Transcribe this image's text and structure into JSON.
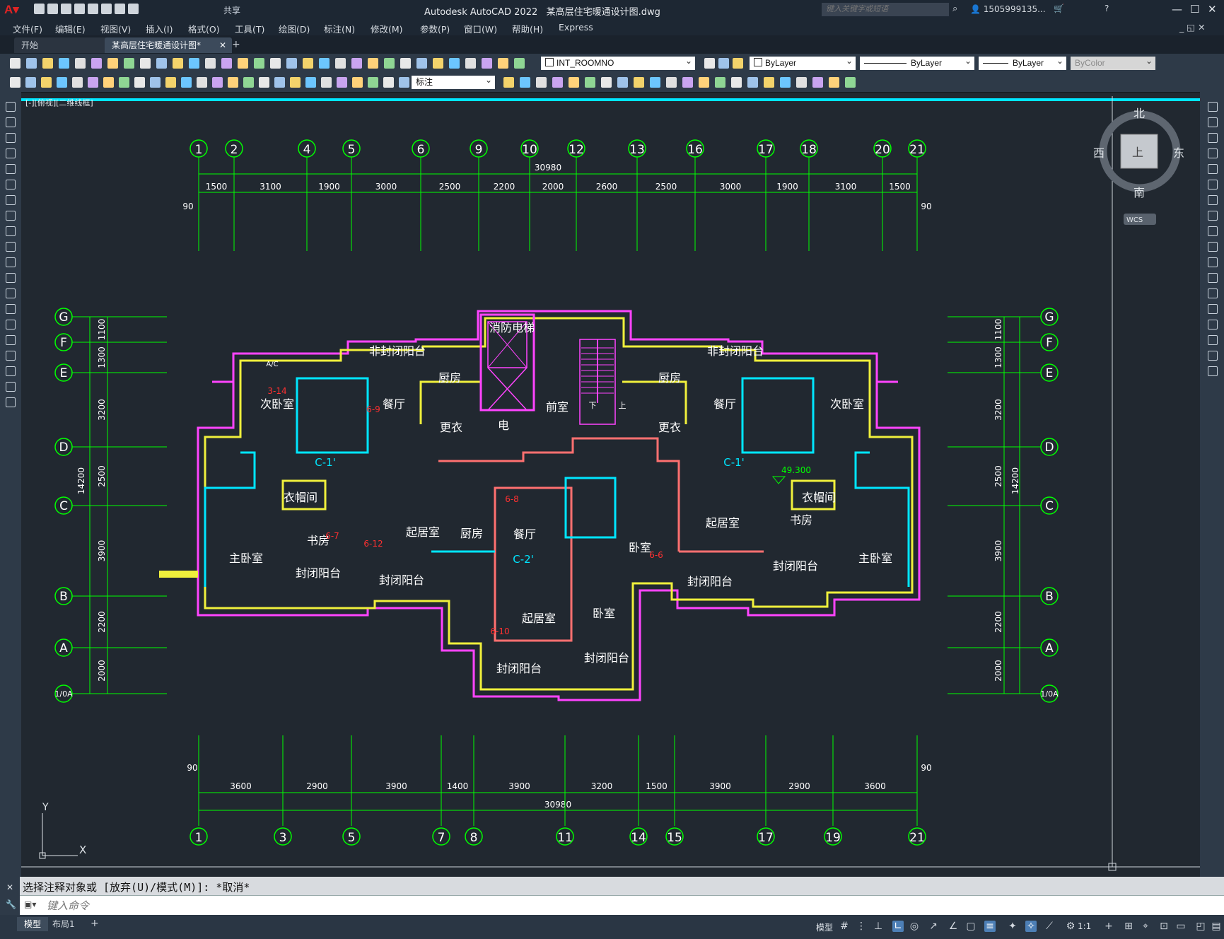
{
  "app": {
    "name": "Autodesk AutoCAD 2022",
    "document": "某高层住宅暖通设计图.dwg",
    "share": "共享"
  },
  "search": {
    "placeholder": "键入关键字或短语"
  },
  "user": {
    "name": "1505999135..."
  },
  "menus": [
    "文件(F)",
    "编辑(E)",
    "视图(V)",
    "插入(I)",
    "格式(O)",
    "工具(T)",
    "绘图(D)",
    "标注(N)",
    "修改(M)",
    "参数(P)",
    "窗口(W)",
    "帮助(H)",
    "Express"
  ],
  "tabs": {
    "start": "开始",
    "doc": "某高层住宅暖通设计图*"
  },
  "toolbar": {
    "layer": "INT_ROOMNO",
    "color": "ByLayer",
    "linetype": "ByLayer",
    "lineweight": "ByLayer",
    "plotstyle": "ByColor",
    "dimstyle": "标注"
  },
  "viewlabel": "[-][俯视][二维线框]",
  "viewcube": {
    "north": "北",
    "south": "南",
    "east": "东",
    "west": "西",
    "face": "上",
    "wcs": "WCS"
  },
  "colors": {
    "axis": "#00ff00",
    "wall_yellow": "#f0f03c",
    "cyan": "#00e6ff",
    "magenta": "#ff44ff",
    "red": "#ff3030",
    "white": "#ffffff"
  },
  "drawing": {
    "top_axes": [
      "1",
      "2",
      "4",
      "5",
      "6",
      "9",
      "10",
      "12",
      "13",
      "16",
      "17",
      "18",
      "20",
      "21"
    ],
    "top_dims": [
      "1500",
      "3100",
      "1900",
      "3000",
      "2500",
      "2200",
      "2000",
      "2600",
      "2500",
      "3000",
      "1900",
      "3100",
      "1500"
    ],
    "top_total": "30980",
    "bottom_axes": [
      "1",
      "3",
      "5",
      "7",
      "8",
      "11",
      "14",
      "15",
      "17",
      "19",
      "21"
    ],
    "bottom_dims": [
      "3600",
      "2900",
      "3900",
      "1400",
      "3900",
      "3200",
      "1500",
      "3900",
      "2900",
      "3600"
    ],
    "bottom_total": "30980",
    "edge_dim": "90",
    "row_axes": [
      "G",
      "F",
      "E",
      "D",
      "C",
      "B",
      "A",
      "1/0A"
    ],
    "row_dims": [
      "1100",
      "1300",
      "3200",
      "2500",
      "3900",
      "2200",
      "2000"
    ],
    "row_total": "14200",
    "elevation": "49.300",
    "rooms": [
      "消防电梯",
      "非封闭阳台",
      "非封闭阳台",
      "厨房",
      "厨房",
      "厨房",
      "餐厅",
      "餐厅",
      "餐厅",
      "次卧室",
      "次卧室",
      "前室",
      "更衣",
      "更衣",
      "电",
      "衣帽间",
      "衣帽间",
      "书房",
      "书房",
      "主卧室",
      "主卧室",
      "起居室",
      "起居室",
      "起居室",
      "卧室",
      "卧室",
      "封闭阳台",
      "封闭阳台",
      "封闭阳台",
      "封闭阳台",
      "封闭阳台",
      "封闭阳台",
      "下",
      "上"
    ],
    "tags": [
      "C-1'",
      "C-1'",
      "C-2'",
      "A/C",
      "3-14",
      "6-9",
      "6-8",
      "6-7",
      "6-12",
      "6-10",
      "6-6"
    ]
  },
  "ucs": {
    "x": "X",
    "y": "Y"
  },
  "command": {
    "history": "选择注释对象或 [放弃(U)/模式(M)]: *取消*",
    "placeholder": "键入命令"
  },
  "layouts": {
    "model": "模型",
    "layout1": "布局1"
  },
  "status": {
    "model": "模型",
    "scale": "1:1"
  }
}
